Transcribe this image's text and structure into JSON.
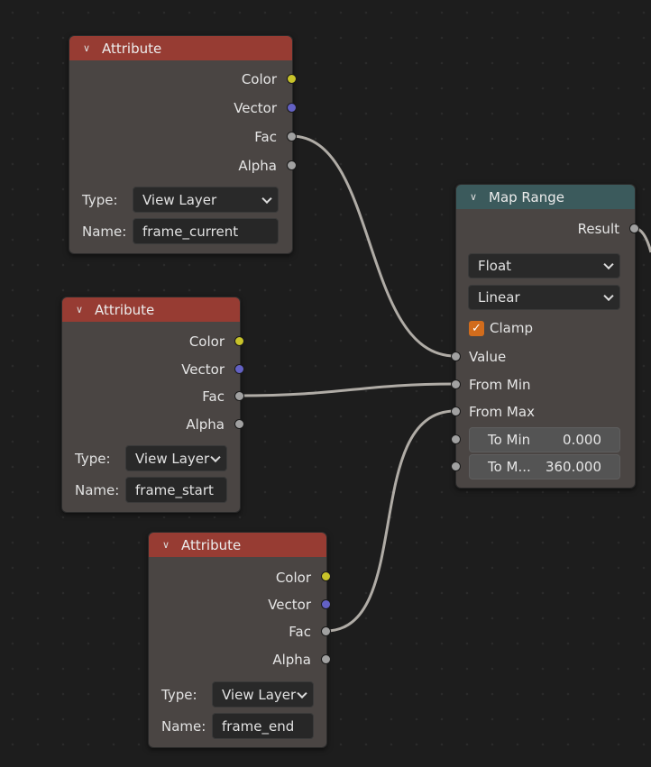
{
  "nodes": {
    "attr1": {
      "title": "Attribute",
      "outputs": [
        "Color",
        "Vector",
        "Fac",
        "Alpha"
      ],
      "type_label": "Type:",
      "type_value": "View Layer",
      "name_label": "Name:",
      "name_value": "frame_current"
    },
    "attr2": {
      "title": "Attribute",
      "outputs": [
        "Color",
        "Vector",
        "Fac",
        "Alpha"
      ],
      "type_label": "Type:",
      "type_value": "View Layer",
      "name_label": "Name:",
      "name_value": "frame_start"
    },
    "attr3": {
      "title": "Attribute",
      "outputs": [
        "Color",
        "Vector",
        "Fac",
        "Alpha"
      ],
      "type_label": "Type:",
      "type_value": "View Layer",
      "name_label": "Name:",
      "name_value": "frame_end"
    },
    "map_range": {
      "title": "Map Range",
      "output": "Result",
      "data_type": "Float",
      "interpolation": "Linear",
      "clamp_label": "Clamp",
      "clamp_checked": true,
      "inputs": [
        "Value",
        "From Min",
        "From Max"
      ],
      "to_min_label": "To Min",
      "to_min_value": "0.000",
      "to_max_label": "To M...",
      "to_max_value": "360.000"
    }
  },
  "colors": {
    "attribute_header": "#973c33",
    "map_range_header": "#3b5a5c",
    "socket_color": "#c8c32a",
    "socket_vector": "#6361c4",
    "socket_float": "#a1a1a1",
    "checkbox": "#d26c1c"
  }
}
